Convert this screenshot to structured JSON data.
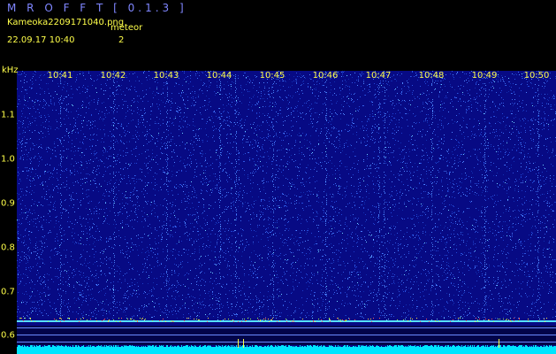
{
  "header": {
    "app_title": "M R O F F T  [ 0.1.3 ]",
    "file_name": "Kameoka2209171040.png",
    "meteor_label": "meteor",
    "timestamp": "22.09.17  10:40",
    "meteor_count": "2"
  },
  "axes": {
    "unit_label": "kHz",
    "time_ticks": [
      "10:41",
      "10:42",
      "10:43",
      "10:44",
      "10:45",
      "10:46",
      "10:47",
      "10:48",
      "10:49",
      "10:50"
    ],
    "freq_ticks": [
      "1.1",
      "1.0",
      "0.9",
      "0.8",
      "0.7",
      "0.6"
    ]
  },
  "colors": {
    "background": "#000000",
    "spectrogram_bg": "#070a84",
    "noise_dots": "#2e55e0",
    "label_yellow": "#ffff4a",
    "title_blue": "#7f86ff",
    "carrier_line": "#55e0ff",
    "baseline": "#00e5ff"
  }
}
